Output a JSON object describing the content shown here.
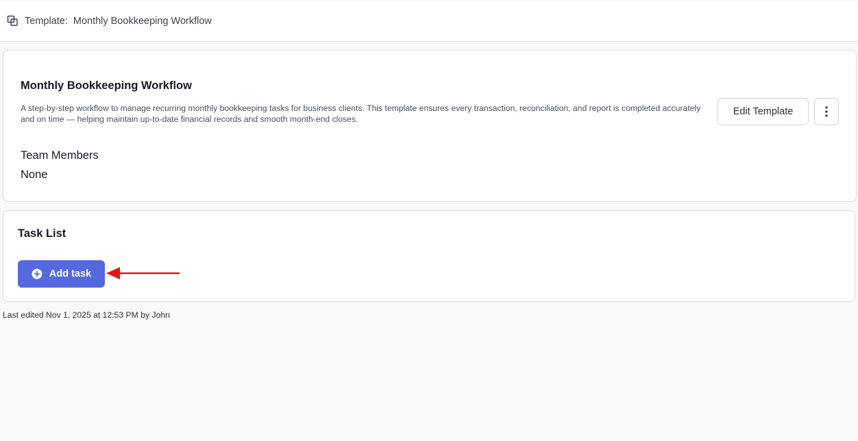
{
  "header": {
    "label": "Template:",
    "template_name": "Monthly Bookkeeping Workflow",
    "icon": "template-copy-icon"
  },
  "template_card": {
    "title": "Monthly Bookkeeping Workflow",
    "description": "A step-by-step workflow to manage recurring monthly bookkeeping tasks for business clients. This template ensures every transaction, reconciliation, and report is completed accurately and on time — helping maintain up-to-date financial records and smooth month-end closes.",
    "edit_button_label": "Edit Template",
    "more_icon": "more-vertical-icon",
    "team_members_title": "Team Members",
    "team_members_value": "None"
  },
  "task_list": {
    "title": "Task List",
    "add_button_label": "Add task",
    "add_icon": "plus-circle-icon"
  },
  "footer": {
    "last_edited": "Last edited Nov 1, 2025 at 12:53 PM by John"
  },
  "colors": {
    "primary": "#5468e0",
    "annotation_arrow": "#e11515",
    "background": "#f8f9fb"
  }
}
